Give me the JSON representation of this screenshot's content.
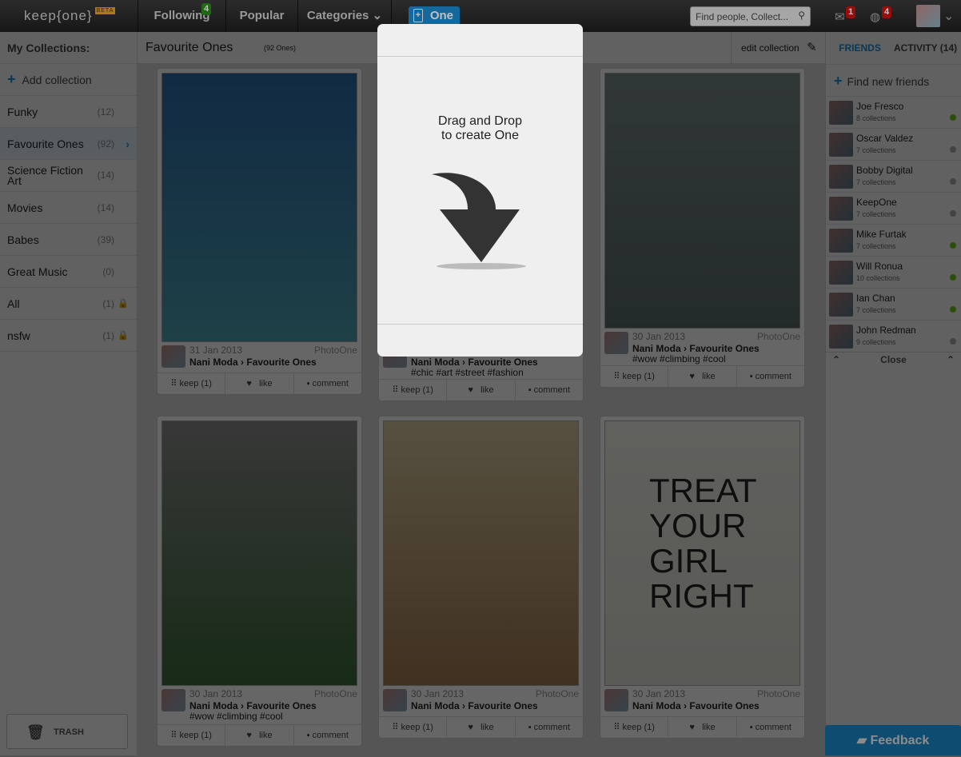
{
  "topbar": {
    "logo": "keep{one}",
    "beta": "BETA",
    "nav": [
      {
        "label": "Following",
        "badge": "4"
      },
      {
        "label": "Popular"
      },
      {
        "label": "Categories"
      }
    ],
    "one_button": "One",
    "search_placeholder": "Find people, Collect...",
    "messages_badge": "1",
    "notifications_badge": "4"
  },
  "sidebar": {
    "title": "My Collections:",
    "add": "Add collection",
    "items": [
      {
        "label": "Funky",
        "count": "(12)"
      },
      {
        "label": "Favourite Ones",
        "count": "(92)",
        "selected": true
      },
      {
        "label": "Science Fiction Art",
        "count": "(14)"
      },
      {
        "label": "Movies",
        "count": "(14)"
      },
      {
        "label": "Babes",
        "count": "(39)"
      },
      {
        "label": "Great Music",
        "count": "(0)"
      },
      {
        "label": "All",
        "count": "(1)",
        "locked": true
      },
      {
        "label": "nsfw",
        "count": "(1)",
        "locked": true
      }
    ],
    "trash": "TRASH"
  },
  "main": {
    "title": "Favourite Ones",
    "count": "(92 Ones)",
    "edit": "edit collection",
    "cards": [
      {
        "date": "31 Jan 2013",
        "type": "PhotoOne",
        "user": "Nani Moda",
        "collection": "Favourite Ones",
        "tags": "",
        "keep": "keep (1)",
        "like": "like",
        "comment": "comment",
        "colors": [
          "#2a6aa8",
          "#4aa0b0"
        ]
      },
      {
        "date": "",
        "type": "",
        "user": "Nani Moda",
        "collection": "Favourite Ones",
        "tags": "#chic #art #street #fashion",
        "keep": "keep (1)",
        "like": "like",
        "comment": "comment",
        "colors": [
          "#777",
          "#999"
        ]
      },
      {
        "date": "30 Jan 2013",
        "type": "PhotoOne",
        "user": "Nani Moda",
        "collection": "Favourite Ones",
        "tags": "#wow #climbing #cool",
        "keep": "keep (1)",
        "like": "like",
        "comment": "comment",
        "colors": [
          "#7a8a8a",
          "#5a6a6a"
        ]
      },
      {
        "date": "30 Jan 2013",
        "type": "PhotoOne",
        "user": "Nani Moda",
        "collection": "Favourite Ones",
        "tags": "#wow #climbing #cool",
        "keep": "keep (1)",
        "like": "like",
        "comment": "comment",
        "colors": [
          "#8a8a8a",
          "#3a6a3a"
        ]
      },
      {
        "date": "30 Jan 2013",
        "type": "PhotoOne",
        "user": "Nani Moda",
        "collection": "Favourite Ones",
        "tags": "",
        "keep": "keep (1)",
        "like": "like",
        "comment": "comment",
        "colors": [
          "#d8c8a0",
          "#a07850"
        ]
      },
      {
        "date": "30 Jan 2013",
        "type": "PhotoOne",
        "user": "Nani Moda",
        "collection": "Favourite Ones",
        "tags": "",
        "keep": "keep (1)",
        "like": "like",
        "comment": "comment",
        "colors": [
          "#f0f0ea",
          "#e0e0d8"
        ],
        "shirt_text": "TREAT YOUR GIRL RIGHT"
      }
    ]
  },
  "friends": {
    "tab_friends": "FRIENDS",
    "tab_activity": "ACTIVITY (14)",
    "find": "Find new friends",
    "list": [
      {
        "name": "Joe Fresco",
        "collections": "8 collections",
        "online": true
      },
      {
        "name": "Oscar Valdez",
        "collections": "7 collections",
        "online": false
      },
      {
        "name": "Bobby Digital",
        "collections": "7 collections",
        "online": false
      },
      {
        "name": "KeepOne",
        "collections": "7 collections",
        "online": false
      },
      {
        "name": "Mike Furtak",
        "collections": "7 collections",
        "online": true
      },
      {
        "name": "Will Ronua",
        "collections": "10 collections",
        "online": true
      },
      {
        "name": "Ian Chan",
        "collections": "7 collections",
        "online": true
      },
      {
        "name": "John Redman",
        "collections": "9 collections",
        "online": false
      }
    ],
    "close": "Close"
  },
  "feedback": "Feedback",
  "modal": {
    "line1": "Drag and Drop",
    "line2": "to create One"
  },
  "colors": {
    "accent": "#1a8ad0",
    "online": "#6ec21e",
    "offline": "#aaaaaa"
  }
}
